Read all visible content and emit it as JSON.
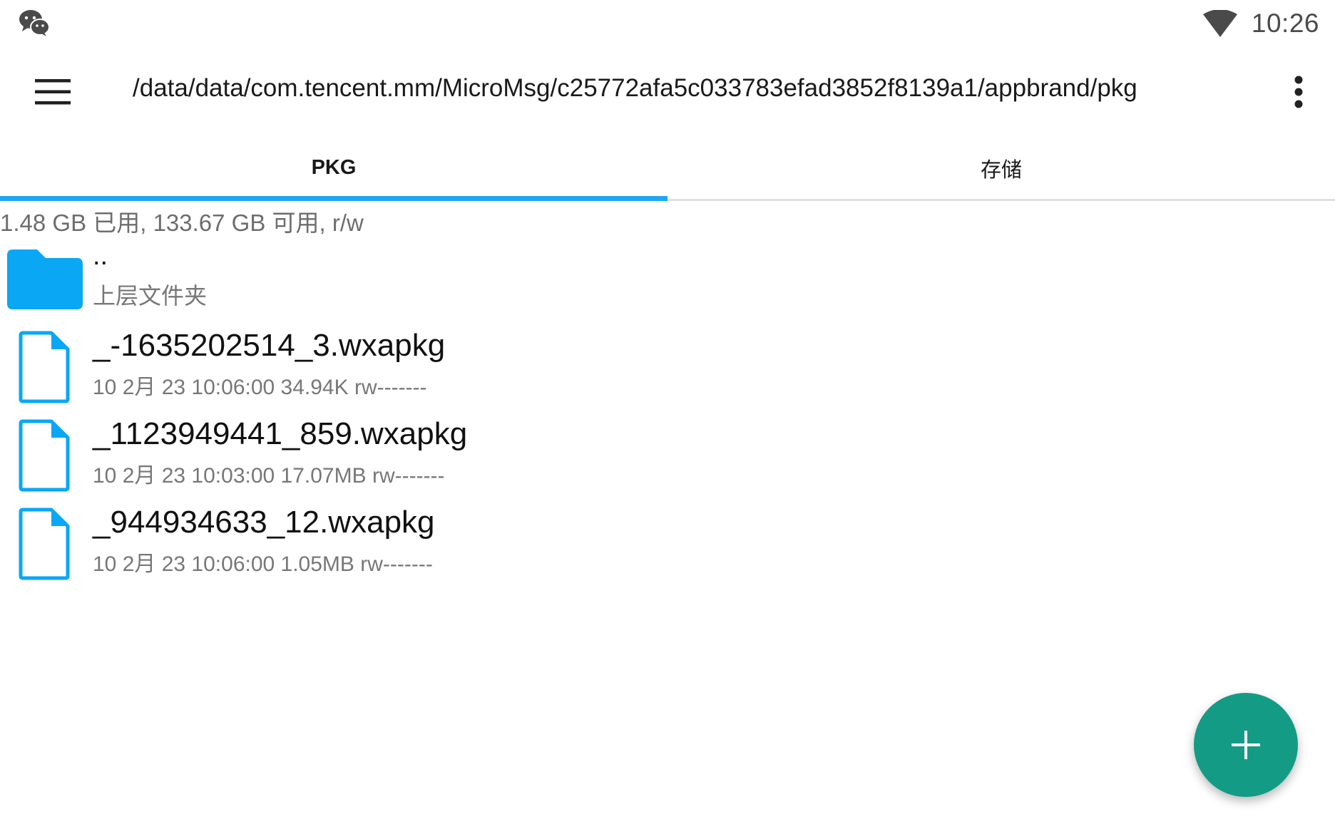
{
  "status_bar": {
    "time": "10:26",
    "left_icon": "wechat-icon",
    "right_icon": "wifi-icon"
  },
  "toolbar": {
    "menu_icon": "hamburger-menu-icon",
    "path": "/data/data/com.tencent.mm/MicroMsg/c25772afa5c033783efad3852f8139a1/appbrand/pkg",
    "overflow_icon": "more-vert-icon"
  },
  "tabs": [
    {
      "label": "PKG",
      "active": true
    },
    {
      "label": "存储",
      "active": false
    }
  ],
  "storage_info": "1.48 GB 已用, 133.67 GB 可用, r/w",
  "parent_folder": {
    "name": "..",
    "subtitle": "上层文件夹",
    "icon": "folder-icon"
  },
  "files": [
    {
      "name": "_-1635202514_3.wxapkg",
      "meta": "10 2月 23 10:06:00  34.94K  rw-------",
      "icon": "file-icon"
    },
    {
      "name": "_1123949441_859.wxapkg",
      "meta": "10 2月 23 10:03:00  17.07MB  rw-------",
      "icon": "file-icon"
    },
    {
      "name": "_944934633_12.wxapkg",
      "meta": "10 2月 23 10:06:00  1.05MB  rw-------",
      "icon": "file-icon"
    }
  ],
  "fab": {
    "icon": "plus-icon"
  },
  "colors": {
    "accent": "#1ea7f0",
    "folder": "#0aa7f5",
    "fab": "#149b86"
  }
}
